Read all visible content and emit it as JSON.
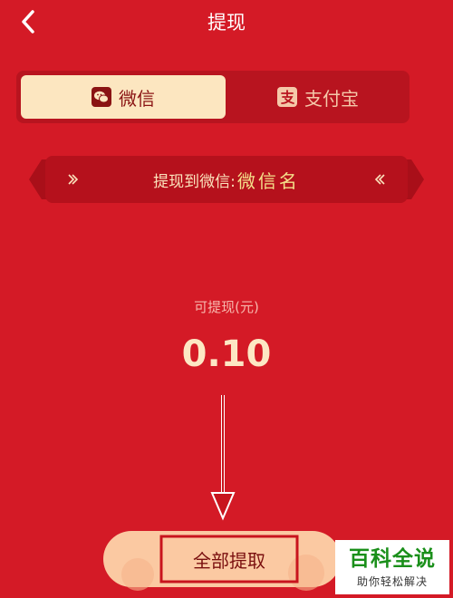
{
  "header": {
    "title": "提现",
    "back_icon": "chevron-left-icon"
  },
  "tabs": [
    {
      "label": "微信",
      "icon": "wechat-icon",
      "selected": true
    },
    {
      "label": "支付宝",
      "icon": "alipay-icon",
      "selected": false
    }
  ],
  "banner": {
    "prefix": "提现到微信:",
    "name": "微信名"
  },
  "amount": {
    "label": "可提现(元)",
    "value": "0.10"
  },
  "action": {
    "withdraw_label": "全部提取"
  },
  "watermark": {
    "title": "百科全说",
    "subtitle": "助你轻松解决"
  },
  "colors": {
    "background": "#d41a26",
    "tab_selected_bg": "#fce6c0",
    "button_bg": "#fbc9a2",
    "annotation_red": "#c8141d",
    "watermark_green": "#1a8f1a"
  }
}
